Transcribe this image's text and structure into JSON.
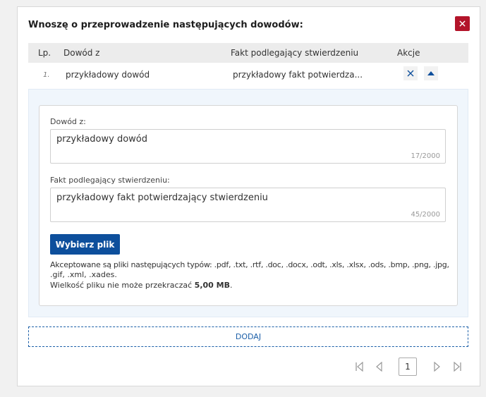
{
  "dialog": {
    "title": "Wnoszę o przeprowadzenie następujących dowodów:",
    "close_icon": "close-icon"
  },
  "table": {
    "headers": {
      "lp": "Lp.",
      "dowod": "Dowód z",
      "fakt": "Fakt podlegający stwierdzeniu",
      "akcje": "Akcje"
    },
    "rows": [
      {
        "lp": "1.",
        "dowod": "przykładowy dowód",
        "fakt": "przykładowy fakt potwierdza..."
      }
    ]
  },
  "form": {
    "dowod_label": "Dowód z:",
    "dowod_value": "przykładowy dowód",
    "dowod_counter": "17/2000",
    "fakt_label": "Fakt podlegający stwierdzeniu:",
    "fakt_value": "przykładowy fakt potwierdzający stwierdzeniu",
    "fakt_counter": "45/2000",
    "pick_file_label": "Wybierz plik",
    "accepted_line1": "Akceptowane są pliki następujących typów: .pdf, .txt, .rtf, .doc, .docx, .odt, .xls, .xlsx, .ods, .bmp, .png, .jpg,",
    "accepted_line2": ".gif, .xml, .xades.",
    "size_prefix": "Wielkość pliku nie może przekraczać",
    "size_value": "5,00 MB",
    "size_suffix": "."
  },
  "add_button_label": "DODAJ",
  "pagination": {
    "current_page": "1"
  },
  "colors": {
    "accent": "#0d4f9c",
    "danger": "#b3142a",
    "link": "#1b5fa8"
  }
}
